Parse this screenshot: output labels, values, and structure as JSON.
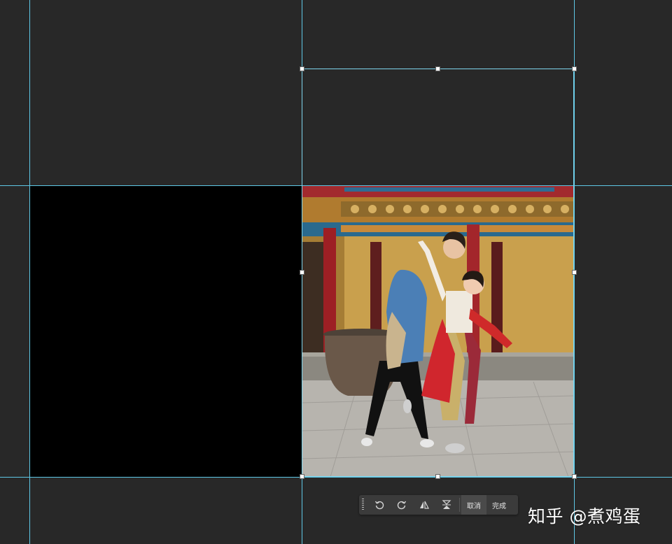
{
  "canvas": {
    "photo_description": "photo-content",
    "black_region": "black-canvas-fill"
  },
  "toolbar": {
    "icons": [
      "grip-icon",
      "rotate-left-icon",
      "rotate-right-icon",
      "flip-horizontal-icon",
      "flip-vertical-icon"
    ],
    "cancel_label": "取消",
    "done_label": "完成"
  },
  "watermark": {
    "text": "知乎 @煮鸡蛋"
  },
  "colors": {
    "background": "#282828",
    "guide": "#5ec8e6",
    "toolbar": "#3b3b3b"
  }
}
